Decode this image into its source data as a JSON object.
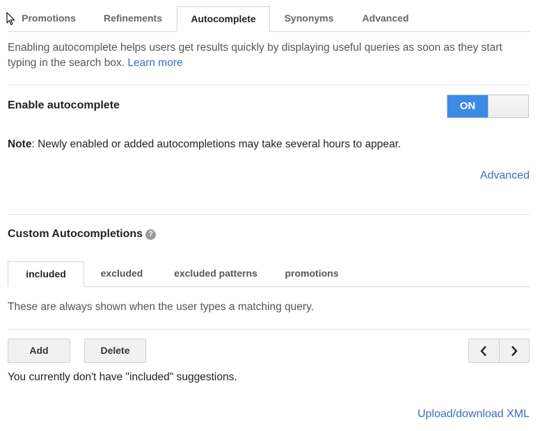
{
  "top_tabs": [
    {
      "label": "Promotions",
      "active": false
    },
    {
      "label": "Refinements",
      "active": false
    },
    {
      "label": "Autocomplete",
      "active": true
    },
    {
      "label": "Synonyms",
      "active": false
    },
    {
      "label": "Advanced",
      "active": false
    }
  ],
  "intro": {
    "text": "Enabling autocomplete helps users get results quickly by displaying useful queries as soon as they start typing in the search box.",
    "learn_more": "Learn more"
  },
  "enable": {
    "title": "Enable autocomplete",
    "toggle_label": "ON",
    "toggle_state": true,
    "toggle_color": "#3d8ae6"
  },
  "note": {
    "label": "Note",
    "text": ": Newly enabled or added autocompletions may take several hours to appear."
  },
  "advanced_link": "Advanced",
  "custom": {
    "title": "Custom Autocompletions",
    "help_icon": "?",
    "tabs": [
      {
        "label": "included",
        "active": true
      },
      {
        "label": "excluded",
        "active": false
      },
      {
        "label": "excluded patterns",
        "active": false
      },
      {
        "label": "promotions",
        "active": false
      }
    ],
    "description": "These are always shown when the user types a matching query.",
    "add_label": "Add",
    "delete_label": "Delete",
    "empty_message": "You currently don't have \"included\" suggestions.",
    "upload_link": "Upload/download XML"
  },
  "colors": {
    "link": "#3b6cc2",
    "accent": "#3d8ae6"
  }
}
